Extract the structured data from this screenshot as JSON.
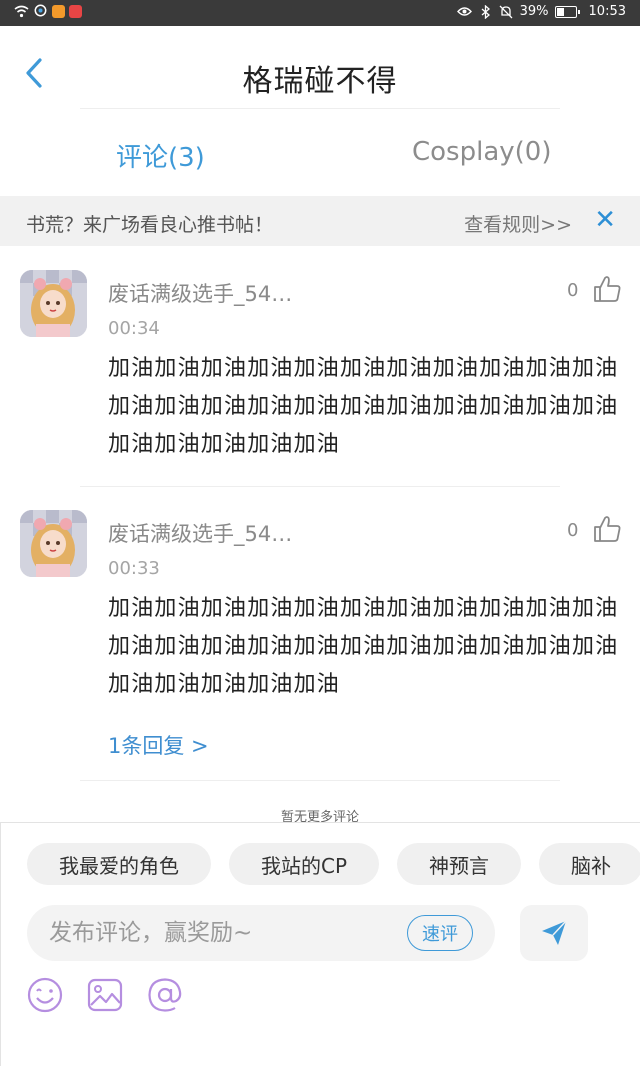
{
  "status_bar": {
    "battery": "39%",
    "time": "10:53"
  },
  "header": {
    "title": "格瑞碰不得"
  },
  "tabs": [
    {
      "label": "评论(3)",
      "active": true
    },
    {
      "label": "Cosplay(0)",
      "active": false
    }
  ],
  "notice": {
    "text": "书荒？来广场看良心推书帖！",
    "rules": "查看规则>>",
    "close": "✕"
  },
  "comments": [
    {
      "user": "废话满级选手_54…",
      "time": "00:34",
      "likes": "0",
      "text": "加油加油加油加油加油加油加油加油加油加油加油加油加油加油加油加油加油加油加油加油加油加油加油加油加油加油加油"
    },
    {
      "user": "废话满级选手_54…",
      "time": "00:33",
      "likes": "0",
      "text": "加油加油加油加油加油加油加油加油加油加油加油加油加油加油加油加油加油加油加油加油加油加油加油加油加油加油加油",
      "replies": "1条回复 >"
    }
  ],
  "no_more": "暂无更多评论",
  "chips": [
    "我最爱的角色",
    "我站的CP",
    "神预言",
    "脑补"
  ],
  "composer": {
    "placeholder": "发布评论，赢奖励~",
    "quick_label": "速评"
  },
  "colors": {
    "accent": "#3f9ad8",
    "tool_purple": "#b58ee0"
  }
}
